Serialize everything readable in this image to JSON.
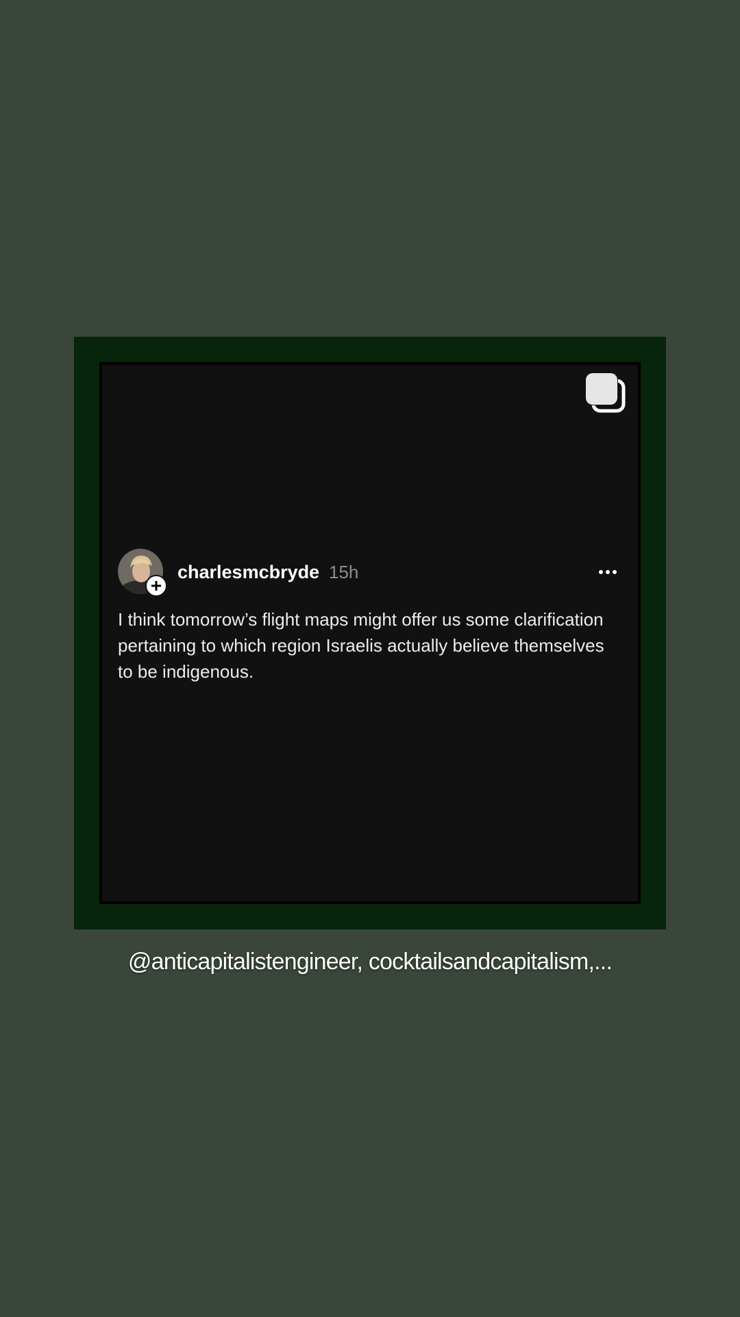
{
  "post": {
    "username": "charlesmcbryde",
    "timestamp": "15h",
    "text": "I think tomorrow’s flight maps might offer us some clarification pertaining to which region Israelis actually believe themselves to be indigenous.",
    "avatar_icon": "user-avatar-photo",
    "follow_icon": "plus-circle-icon",
    "more_icon": "more-horizontal-icon",
    "carousel_icon": "multiple-posts-icon"
  },
  "story": {
    "mentions": "@anticapitalistengineer, cocktailsandcapitalism,..."
  },
  "colors": {
    "background": "#3b463a",
    "frame": "#06250a",
    "card": "#121112",
    "text_primary": "#ffffff",
    "text_secondary": "#8c8c8c"
  }
}
